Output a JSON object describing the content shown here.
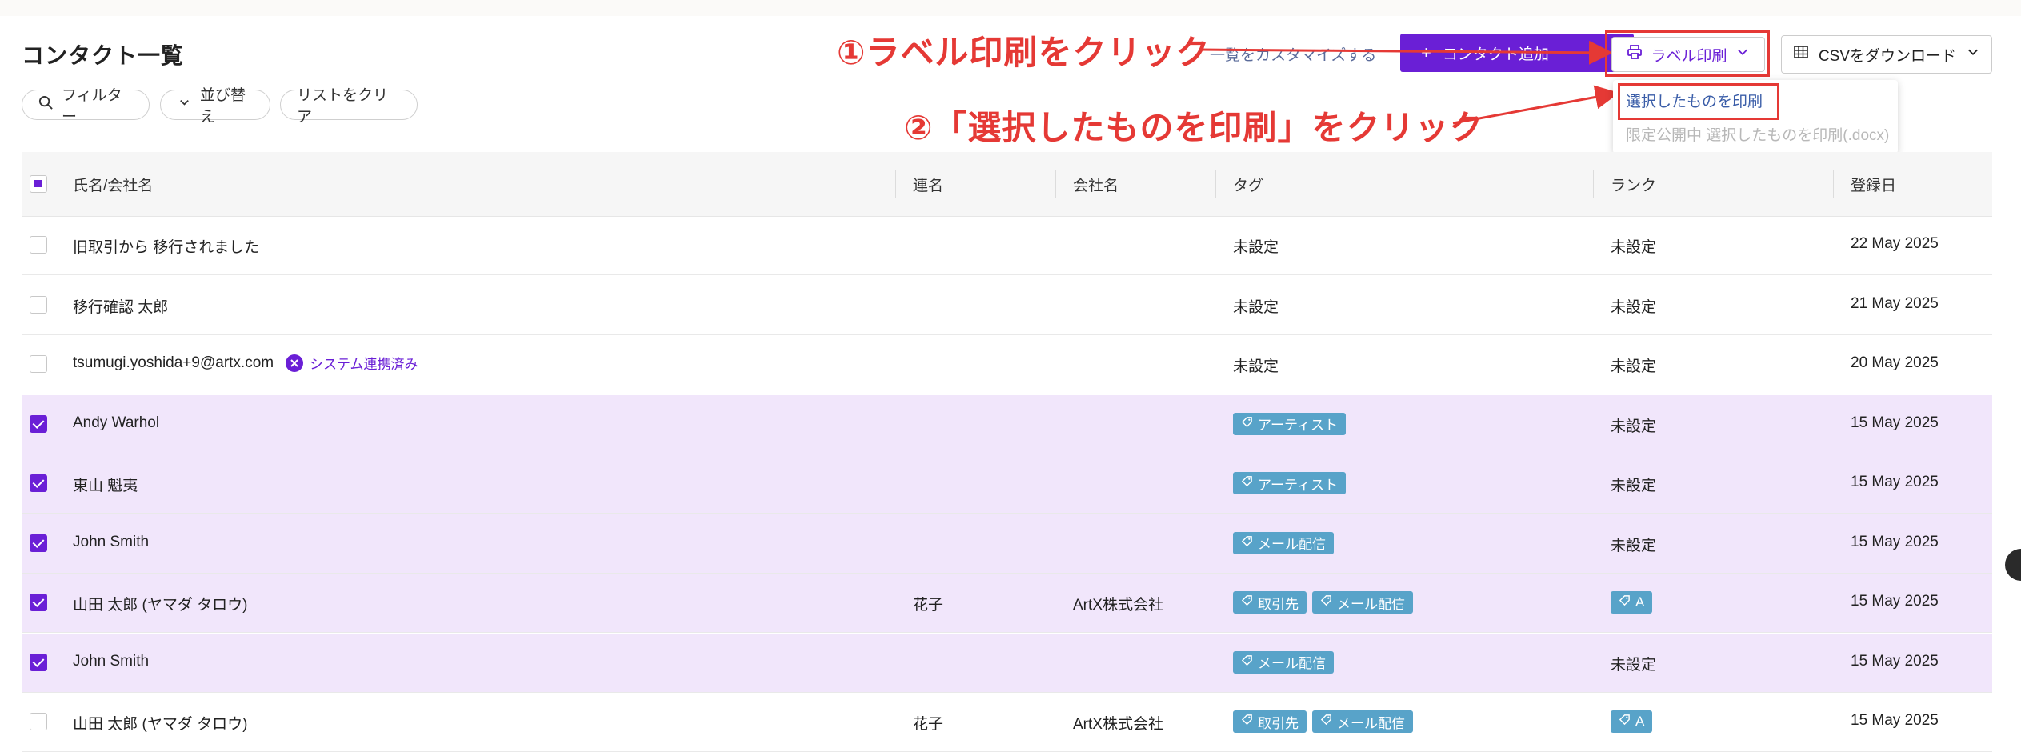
{
  "page": {
    "title": "コンタクト一覧"
  },
  "filters": {
    "filter_label": "フィルター",
    "sort_label": "並び替え",
    "clear_label": "リストをクリア"
  },
  "toolbar": {
    "customize_label": "一覧をカスタマイズする",
    "add_contact_label": "コンタクト追加",
    "label_print_label": "ラベル印刷",
    "csv_label": "CSVをダウンロード"
  },
  "dropdown": {
    "print_selected": "選択したものを印刷",
    "print_docx": "限定公開中 選択したものを印刷(.docx)"
  },
  "annotations": {
    "step1": "①ラベル印刷をクリック",
    "step2": "②「選択したものを印刷」をクリック",
    "color": "#e53935"
  },
  "table": {
    "columns": [
      "氏名/会社名",
      "連名",
      "会社名",
      "タグ",
      "ランク",
      "登録日"
    ],
    "rows": [
      {
        "checked": false,
        "name": "旧取引から 移行されました",
        "joint": "",
        "company": "",
        "tags": [],
        "tag_text": "未設定",
        "rank": "",
        "rank_text": "未設定",
        "date": "22 May 2025"
      },
      {
        "checked": false,
        "name": "移行確認 太郎",
        "joint": "",
        "company": "",
        "tags": [],
        "tag_text": "未設定",
        "rank": "",
        "rank_text": "未設定",
        "date": "21 May 2025"
      },
      {
        "checked": false,
        "name": "tsumugi.yoshida+9@artx.com",
        "verified": "システム連携済み",
        "joint": "",
        "company": "",
        "tags": [],
        "tag_text": "未設定",
        "rank": "",
        "rank_text": "未設定",
        "date": "20 May 2025"
      },
      {
        "checked": true,
        "name": "Andy Warhol",
        "joint": "",
        "company": "",
        "tags": [
          "アーティスト"
        ],
        "tag_text": "",
        "rank": "",
        "rank_text": "未設定",
        "date": "15 May 2025"
      },
      {
        "checked": true,
        "name": "東山 魁夷",
        "joint": "",
        "company": "",
        "tags": [
          "アーティスト"
        ],
        "tag_text": "",
        "rank": "",
        "rank_text": "未設定",
        "date": "15 May 2025"
      },
      {
        "checked": true,
        "name": "John Smith",
        "joint": "",
        "company": "",
        "tags": [
          "メール配信"
        ],
        "tag_text": "",
        "rank": "",
        "rank_text": "未設定",
        "date": "15 May 2025"
      },
      {
        "checked": true,
        "name": "山田 太郎 (ヤマダ タロウ)",
        "joint": "花子",
        "company": "ArtX株式会社",
        "tags": [
          "取引先",
          "メール配信"
        ],
        "tag_text": "",
        "rank": "A",
        "rank_text": "",
        "date": "15 May 2025"
      },
      {
        "checked": true,
        "name": "John Smith",
        "joint": "",
        "company": "",
        "tags": [
          "メール配信"
        ],
        "tag_text": "",
        "rank": "",
        "rank_text": "未設定",
        "date": "15 May 2025"
      },
      {
        "checked": false,
        "name": "山田 太郎 (ヤマダ タロウ)",
        "joint": "花子",
        "company": "ArtX株式会社",
        "tags": [
          "取引先",
          "メール配信"
        ],
        "tag_text": "",
        "rank": "A",
        "rank_text": "",
        "date": "15 May 2025"
      }
    ]
  },
  "colors": {
    "primary": "#6a1fd6",
    "tag": "#58a3c9",
    "selected_row": "#f1e6fb"
  }
}
